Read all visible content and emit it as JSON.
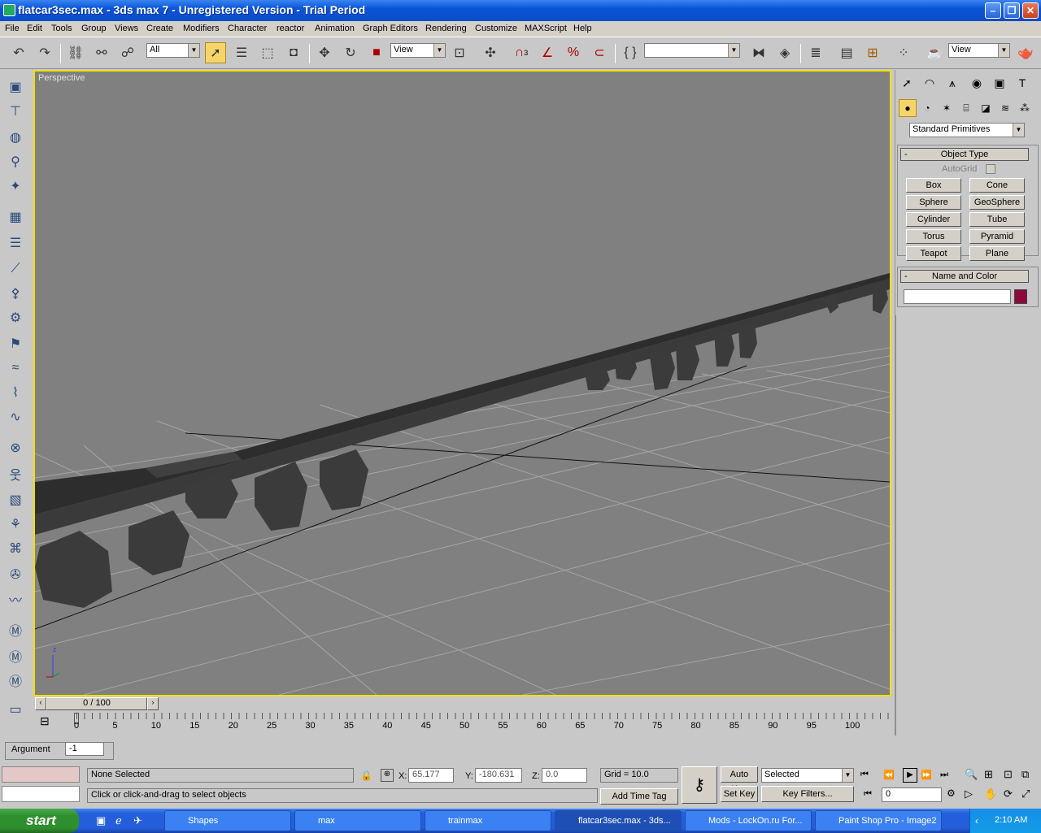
{
  "window": {
    "title": "flatcar3sec.max - 3ds max 7  - Unregistered Version - Trial Period"
  },
  "menu": [
    "File",
    "Edit",
    "Tools",
    "Group",
    "Views",
    "Create",
    "Modifiers",
    "Character",
    "reactor",
    "Animation",
    "Graph Editors",
    "Rendering",
    "Customize",
    "MAXScript",
    "Help"
  ],
  "toolbar": {
    "selection_filter": "All",
    "ref_coord": "View",
    "named_selection": "",
    "render_view": "View",
    "snap_angle_label": "3"
  },
  "viewport": {
    "label": "Perspective",
    "axis_z": "z"
  },
  "command_panel": {
    "category": "Standard Primitives",
    "object_type": {
      "title": "Object Type",
      "autogrid": "AutoGrid",
      "buttons": [
        "Box",
        "Cone",
        "Sphere",
        "GeoSphere",
        "Cylinder",
        "Tube",
        "Torus",
        "Pyramid",
        "Teapot",
        "Plane"
      ]
    },
    "name_color": {
      "title": "Name and Color",
      "name_value": "",
      "color": "#8a0a3a"
    }
  },
  "timeline": {
    "slider": "0 / 100",
    "ticks": [
      "0",
      "5",
      "10",
      "15",
      "20",
      "25",
      "30",
      "35",
      "40",
      "45",
      "50",
      "55",
      "60",
      "65",
      "70",
      "75",
      "80",
      "85",
      "90",
      "95",
      "100"
    ]
  },
  "status": {
    "argument_label": "Argument",
    "argument_value": "-1",
    "selection_text": "None Selected",
    "prompt_text": "Click or click-and-drag to select objects",
    "x_label": "X:",
    "x_value": "65.177",
    "y_label": "Y:",
    "y_value": "-180.631",
    "z_label": "Z:",
    "z_value": "0.0",
    "grid": "Grid = 10.0",
    "add_time_tag": "Add Time Tag",
    "auto_key": "Auto Key",
    "set_key": "Set Key",
    "key_mode": "Selected",
    "key_filters": "Key Filters...",
    "frame": "0"
  },
  "taskbar": {
    "start": "start",
    "tasks": [
      "Shapes",
      "max",
      "trainmax",
      "flatcar3sec.max - 3ds...",
      "Mods - LockOn.ru For...",
      "Paint Shop Pro - Image2"
    ],
    "clock": "2:10 AM"
  },
  "colors": {
    "viewport_border": "#f2e000",
    "name_swatch": "#8a0a3a",
    "taskbar": "#245edb"
  }
}
